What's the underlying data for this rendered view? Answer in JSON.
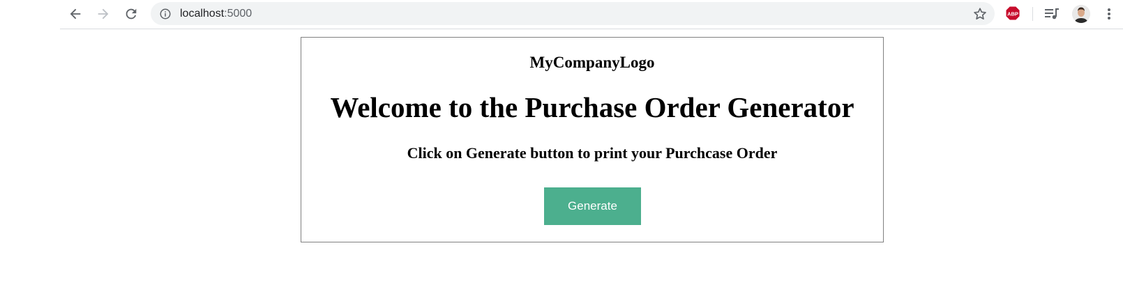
{
  "browser": {
    "url_host": "localhost",
    "url_port": ":5000",
    "extension_badge": "ABP",
    "icons": {
      "back": "arrow-left-icon",
      "forward": "arrow-right-icon",
      "reload": "reload-icon",
      "info": "info-icon",
      "bookmark": "star-icon",
      "adblock": "abp-icon",
      "media": "media-queue-icon",
      "profile": "avatar",
      "menu": "vertical-dots-icon"
    }
  },
  "page": {
    "logo_text": "MyCompanyLogo",
    "title": "Welcome to the Purchase Order Generator",
    "instruction": "Click on Generate button to print your Purchcase Order",
    "generate_label": "Generate"
  },
  "colors": {
    "button_bg": "#4caf8e",
    "button_text": "#ffffff",
    "card_border": "#808080",
    "omnibox_bg": "#f1f3f4",
    "abp_red": "#c70d2c"
  }
}
